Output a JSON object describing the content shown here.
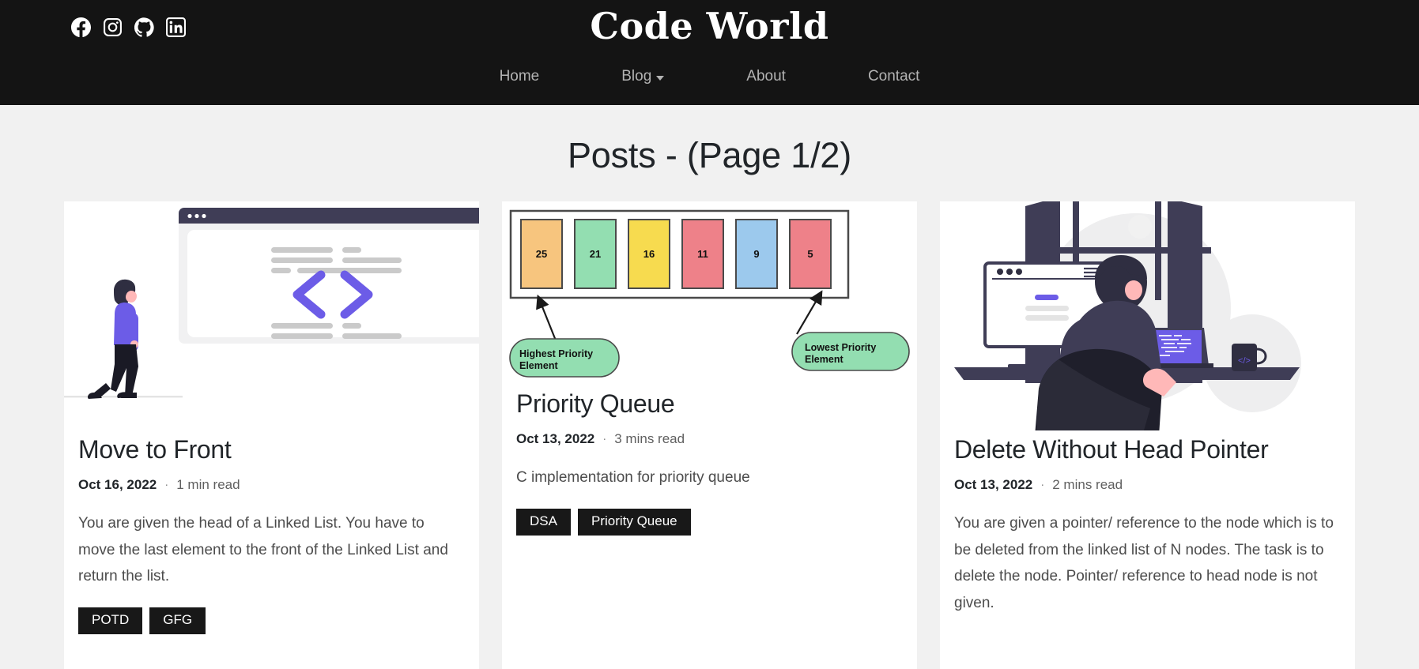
{
  "header": {
    "brand": "Code World",
    "social": [
      {
        "name": "facebook-icon",
        "label": "Facebook"
      },
      {
        "name": "instagram-icon",
        "label": "Instagram"
      },
      {
        "name": "github-icon",
        "label": "GitHub"
      },
      {
        "name": "linkedin-icon",
        "label": "LinkedIn"
      }
    ],
    "nav": [
      {
        "label": "Home",
        "dropdown": false
      },
      {
        "label": "Blog",
        "dropdown": true
      },
      {
        "label": "About",
        "dropdown": false
      },
      {
        "label": "Contact",
        "dropdown": false
      }
    ],
    "bg_color": "#141414",
    "nav_color": "#b3b3b3"
  },
  "page": {
    "title": "Posts - (Page 1/2)",
    "background": "#f1f1f1"
  },
  "posts": [
    {
      "title": "Move to Front",
      "date": "Oct 16, 2022",
      "separator": "·",
      "read_time": "1 min read",
      "description": "You are given the head of a Linked List. You have to move the last element to the front of the Linked List and return the list.",
      "tags": [
        "POTD",
        "GFG"
      ],
      "illustration": "developer-walking-code-window"
    },
    {
      "title": "Priority Queue",
      "date": "Oct 13, 2022",
      "separator": "·",
      "read_time": "3 mins read",
      "description": "C implementation for priority queue",
      "tags": [
        "DSA",
        "Priority Queue"
      ],
      "illustration": "priority-queue-diagram"
    },
    {
      "title": "Delete Without Head Pointer",
      "date": "Oct 13, 2022",
      "separator": "·",
      "read_time": "2 mins read",
      "description": "You are given a pointer/ reference to the node which is to be deleted from the linked list of N nodes. The task is to delete the node. Pointer/ reference to head node is not given.",
      "tags": [],
      "illustration": "developer-at-desk"
    }
  ],
  "priority_queue_diagram": {
    "elements": [
      {
        "value": "25",
        "color": "#F7C57E"
      },
      {
        "value": "21",
        "color": "#93DEB1"
      },
      {
        "value": "16",
        "color": "#F7DB4F"
      },
      {
        "value": "11",
        "color": "#EE8189"
      },
      {
        "value": "9",
        "color": "#9CC9ED"
      },
      {
        "value": "5",
        "color": "#EE8189"
      }
    ],
    "callouts": [
      {
        "text": "Highest Priority Element",
        "color": "#93DEB1"
      },
      {
        "text": "Lowest Priority Element",
        "color": "#93DEB1"
      }
    ]
  },
  "theme": {
    "accent_purple": "#6C5CE7",
    "tag_bg": "#181818",
    "card_bg": "#ffffff",
    "text_dark": "#212529"
  }
}
